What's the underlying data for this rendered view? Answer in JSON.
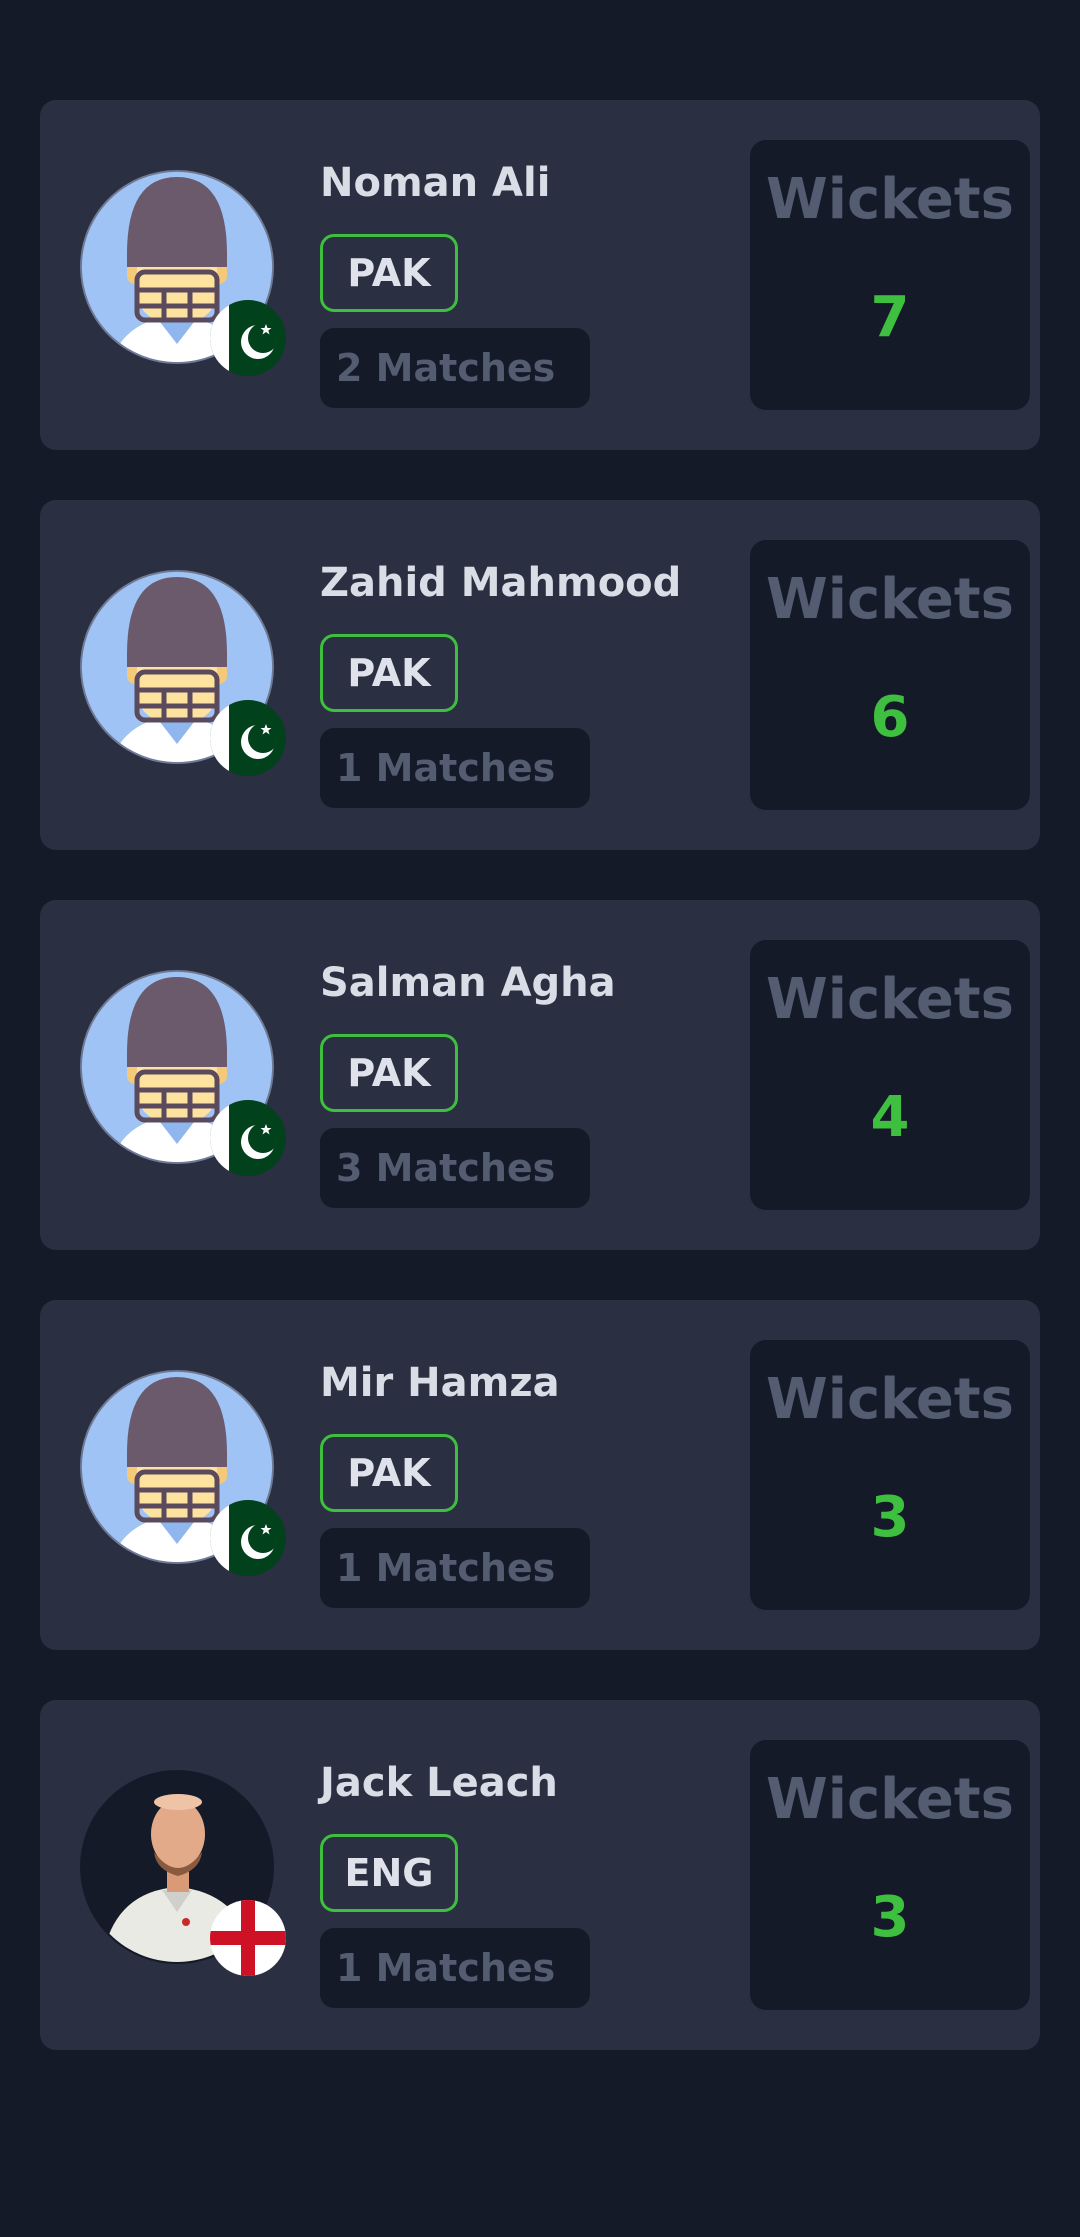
{
  "players": [
    {
      "name": "Noman Ali",
      "team": "PAK",
      "matches": "2 Matches",
      "stat_label": "Wickets",
      "stat_value": "7",
      "avatar": "helmet-avatar",
      "flag": "pakistan-flag-icon"
    },
    {
      "name": "Zahid Mahmood",
      "team": "PAK",
      "matches": "1 Matches",
      "stat_label": "Wickets",
      "stat_value": "6",
      "avatar": "helmet-avatar",
      "flag": "pakistan-flag-icon"
    },
    {
      "name": "Salman Agha",
      "team": "PAK",
      "matches": "3 Matches",
      "stat_label": "Wickets",
      "stat_value": "4",
      "avatar": "helmet-avatar",
      "flag": "pakistan-flag-icon"
    },
    {
      "name": "Mir Hamza",
      "team": "PAK",
      "matches": "1 Matches",
      "stat_label": "Wickets",
      "stat_value": "3",
      "avatar": "helmet-avatar",
      "flag": "pakistan-flag-icon"
    },
    {
      "name": "Jack Leach",
      "team": "ENG",
      "matches": "1 Matches",
      "stat_label": "Wickets",
      "stat_value": "3",
      "avatar": "player-photo",
      "flag": "england-flag-icon"
    }
  ],
  "colors": {
    "background": "#151a29",
    "card": "#2a2f41",
    "accent_green": "#3fbf3f",
    "muted_text": "#545c72",
    "name_text": "#d9dde6"
  }
}
